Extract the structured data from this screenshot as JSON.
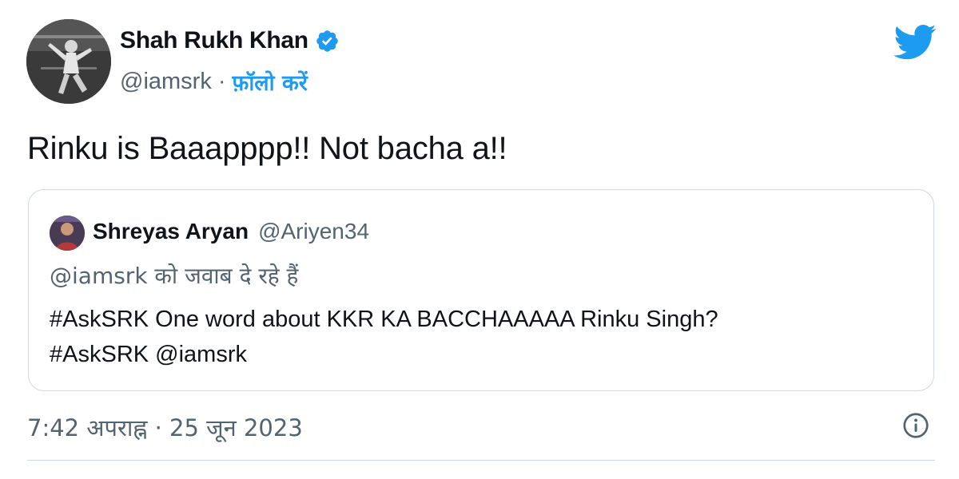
{
  "author": {
    "name": "Shah Rukh Khan",
    "handle": "@iamsrk",
    "separator": "·",
    "follow_label": "फ़ॉलो करें"
  },
  "icons": {
    "verified": "verified-badge-icon",
    "brand": "twitter-bird-icon",
    "info": "info-icon"
  },
  "tweet": {
    "text": "Rinku is Baaapppp!! Not bacha a!!"
  },
  "quoted": {
    "name": "Shreyas Aryan",
    "handle": "@Ariyen34",
    "reply_context": "@iamsrk को जवाब दे रहे हैं",
    "line1": "#AskSRK One word about KKR KA BACCHAAAAA Rinku Singh?",
    "line2": "#AskSRK @iamsrk"
  },
  "meta": {
    "timestamp": "7:42 अपराह्न · 25 जून 2023"
  },
  "colors": {
    "accent": "#1d9bf0",
    "text": "#0f1419",
    "secondary": "#536471",
    "border": "#cfd9de"
  }
}
